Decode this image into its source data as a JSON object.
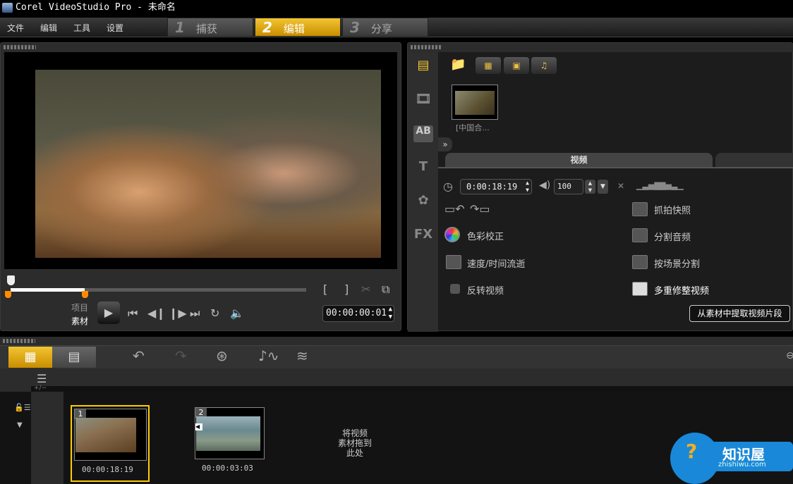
{
  "titlebar": {
    "title": "Corel VideoStudio Pro - 未命名"
  },
  "menu": [
    "文件",
    "编辑",
    "工具",
    "设置"
  ],
  "steps": [
    {
      "num": "1",
      "label": "捕获",
      "active": false
    },
    {
      "num": "2",
      "label": "编辑",
      "active": true
    },
    {
      "num": "3",
      "label": "分享",
      "active": false
    }
  ],
  "preview": {
    "mode_project": "项目",
    "mode_clip": "素材",
    "timecode": "00:00:00:01",
    "trim_progress": 0.25
  },
  "library": {
    "clips": [
      {
        "name": "[中国合..."
      }
    ],
    "options_tab": "视频",
    "duration": "0:00:18:19",
    "volume": "100",
    "options_left": [
      "色彩校正",
      "速度/时间流逝",
      "反转视频"
    ],
    "options_right": [
      "抓拍快照",
      "分割音频",
      "按场景分割",
      "多重修整视频"
    ],
    "tooltip": "从素材中提取视频片段"
  },
  "timeline": {
    "clips": [
      {
        "index": "1",
        "duration": "00:00:18:19",
        "selected": true
      },
      {
        "index": "2",
        "duration": "00:00:03:03",
        "selected": false
      }
    ],
    "drop_hint": [
      "将视频",
      "素材拖到",
      "此处"
    ],
    "zoom_label": "+/−"
  },
  "watermark": {
    "brand": "知识屋",
    "url": "zhishiwu.com"
  },
  "colors": {
    "accent": "#f2c532",
    "selection": "#ffcc00",
    "scrub": "#ff8c00"
  }
}
